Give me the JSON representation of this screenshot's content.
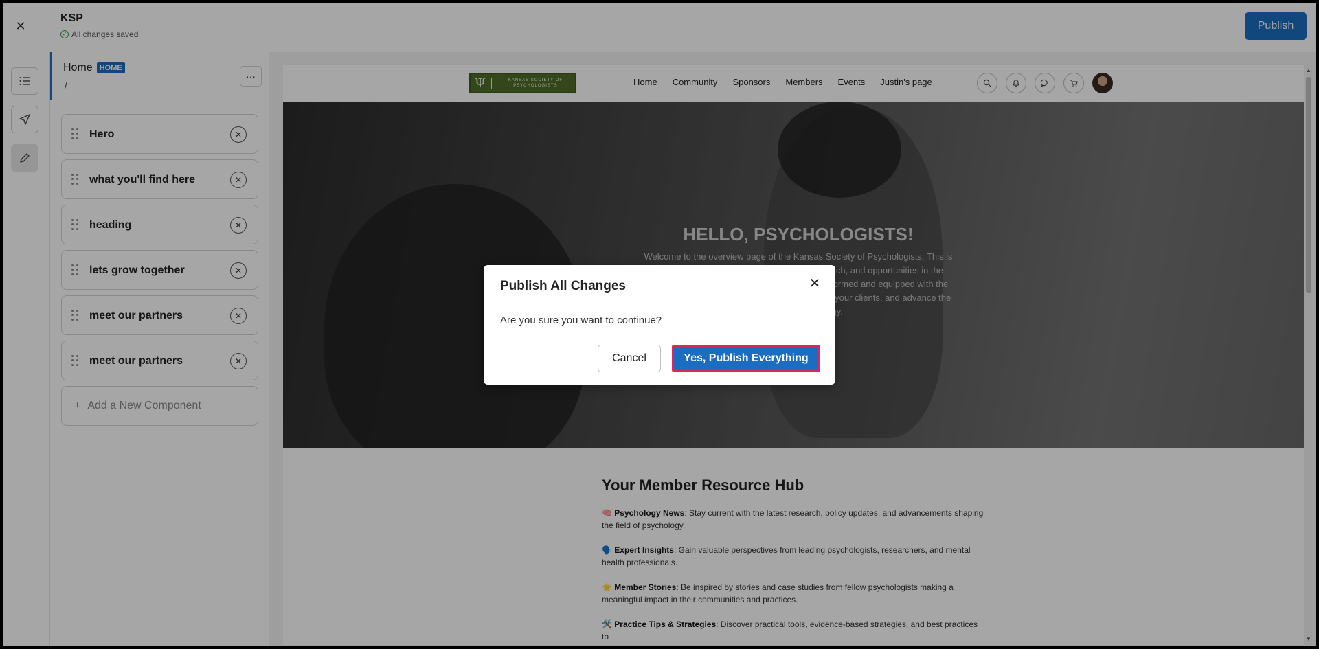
{
  "app": {
    "project_title": "KSP",
    "save_status": "All changes saved",
    "publish_label": "Publish"
  },
  "rail": {
    "items": [
      {
        "name": "list-icon"
      },
      {
        "name": "send-icon"
      },
      {
        "name": "pencil-icon"
      }
    ]
  },
  "sidebar": {
    "page_name": "Home",
    "page_badge": "HOME",
    "page_path": "/",
    "more_label": "···",
    "components": [
      {
        "label": "Hero"
      },
      {
        "label": "what you'll find here"
      },
      {
        "label": "heading"
      },
      {
        "label": "lets grow together"
      },
      {
        "label": "meet our partners"
      },
      {
        "label": "meet our partners"
      }
    ],
    "add_component_label": "Add a New Component"
  },
  "site": {
    "logo_text": "KANSAS SOCIETY OF PSYCHOLOGISTS",
    "nav": [
      "Home",
      "Community",
      "Sponsors",
      "Members",
      "Events",
      "Justin's page"
    ],
    "hero_title": "HELLO, PSYCHOLOGISTS!",
    "hero_text": "Welcome to the overview page of the Kansas Society of Psychologists. This is your go-to resource for the latest news, research, and opportunities in the field. Our mission is to keep you connected, informed and equipped with the tools and knowledge you need to grow, support your clients, and advance the science of psychology.",
    "hub_title": "Your Member Resource Hub",
    "hub_items": [
      {
        "emoji": "🧠",
        "title": "Psychology News",
        "text": ": Stay current with the latest research, policy updates, and advancements shaping the field of psychology."
      },
      {
        "emoji": "🗣️",
        "title": "Expert Insights",
        "text": ": Gain valuable perspectives from leading psychologists, researchers, and mental health professionals."
      },
      {
        "emoji": "🌟",
        "title": "Member Stories",
        "text": ": Be inspired by stories and case studies from fellow psychologists making a meaningful impact in their communities and practices."
      },
      {
        "emoji": "🛠️",
        "title": "Practice Tips & Strategies",
        "text": ": Discover practical tools, evidence-based strategies, and best practices to"
      }
    ]
  },
  "modal": {
    "title": "Publish All Changes",
    "message": "Are you sure you want to continue?",
    "cancel_label": "Cancel",
    "confirm_label": "Yes, Publish Everything"
  },
  "colors": {
    "primary": "#1b6dc1",
    "highlight_border": "#e0245e",
    "saved_check": "#2e9c4a"
  }
}
